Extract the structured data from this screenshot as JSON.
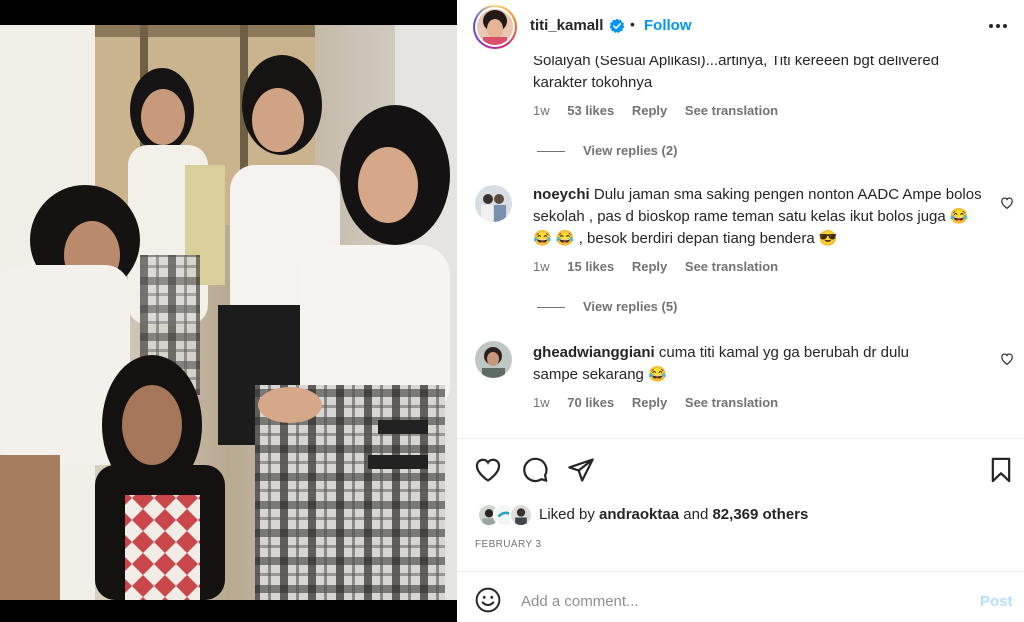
{
  "post": {
    "username": "titi_kamall",
    "verified": true,
    "follow_label": "Follow",
    "dot": "•",
    "more_icon": "more-horizontal-icon"
  },
  "comments": [
    {
      "partial_text_line1": "Solaiyah (Sesuai Aplikasi)...artinya, Titi kereeen bgt delivered",
      "partial_text_line2": "karakter tokohnya",
      "time": "1w",
      "likes": "53 likes",
      "reply": "Reply",
      "translate": "See translation",
      "view_replies": "View replies (2)"
    },
    {
      "username": "noeychi",
      "text": "Dulu jaman sma saking pengen nonton AADC Ampe bolos sekolah , pas d bioskop rame teman satu kelas ikut bolos juga 😂 😂 😂 , besok berdiri depan tiang bendera 😎",
      "time": "1w",
      "likes": "15 likes",
      "reply": "Reply",
      "translate": "See translation",
      "view_replies": "View replies (5)"
    },
    {
      "username": "gheadwianggiani",
      "text": "cuma titi kamal yg ga berubah dr dulu sampe sekarang 😂",
      "time": "1w",
      "likes": "70 likes",
      "reply": "Reply",
      "translate": "See translation"
    }
  ],
  "actions": {
    "like_icon": "heart-icon",
    "comment_icon": "comment-icon",
    "share_icon": "send-icon",
    "save_icon": "bookmark-icon"
  },
  "likes": {
    "prefix": "Liked by",
    "user": "andraoktaa",
    "and": "and",
    "count": "82,369 others"
  },
  "date": "FEBRUARY 3",
  "comment_box": {
    "placeholder": "Add a comment...",
    "post_label": "Post"
  }
}
